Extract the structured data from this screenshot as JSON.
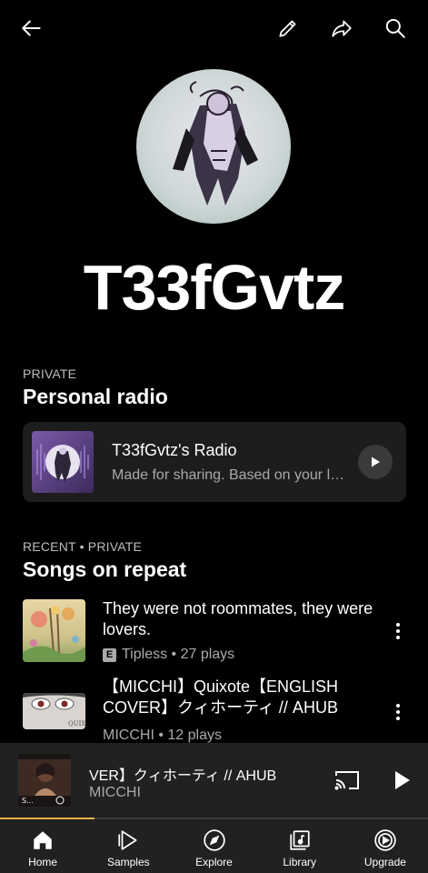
{
  "topbar": {
    "back_icon": "arrow-left-icon",
    "edit_icon": "pencil-icon",
    "share_icon": "share-icon",
    "search_icon": "search-icon"
  },
  "profile": {
    "name": "T33fGvtz"
  },
  "personal_radio": {
    "kicker": "PRIVATE",
    "title": "Personal radio",
    "card": {
      "title": "T33fGvtz's Radio",
      "subtitle": "Made for sharing. Based on your listening"
    }
  },
  "songs_on_repeat": {
    "kicker": "RECENT • PRIVATE",
    "title": "Songs on repeat",
    "items": [
      {
        "title": "They were not roommates, they were lovers.",
        "explicit_badge": "E",
        "meta": "Tipless • 27 plays"
      },
      {
        "title": "【MICCHI】Quixote【ENGLISH COVER】クィホーティ // AHUB",
        "meta": "MICCHI • 12 plays",
        "thumb_text": "QUIX"
      }
    ]
  },
  "mini_player": {
    "title": "VER】クィホーティ // AHUB",
    "artist": "MICCHI",
    "thumb_text": "S...",
    "progress": 0.22
  },
  "nav": [
    {
      "label": "Home",
      "icon": "home-icon",
      "active": true
    },
    {
      "label": "Samples",
      "icon": "samples-icon",
      "active": false
    },
    {
      "label": "Explore",
      "icon": "compass-icon",
      "active": false
    },
    {
      "label": "Library",
      "icon": "library-icon",
      "active": false
    },
    {
      "label": "Upgrade",
      "icon": "upgrade-icon",
      "active": false
    }
  ],
  "colors": {
    "accent": "#e6b24a",
    "background": "#000000",
    "card": "#1d1d1d",
    "bar": "#212121"
  }
}
